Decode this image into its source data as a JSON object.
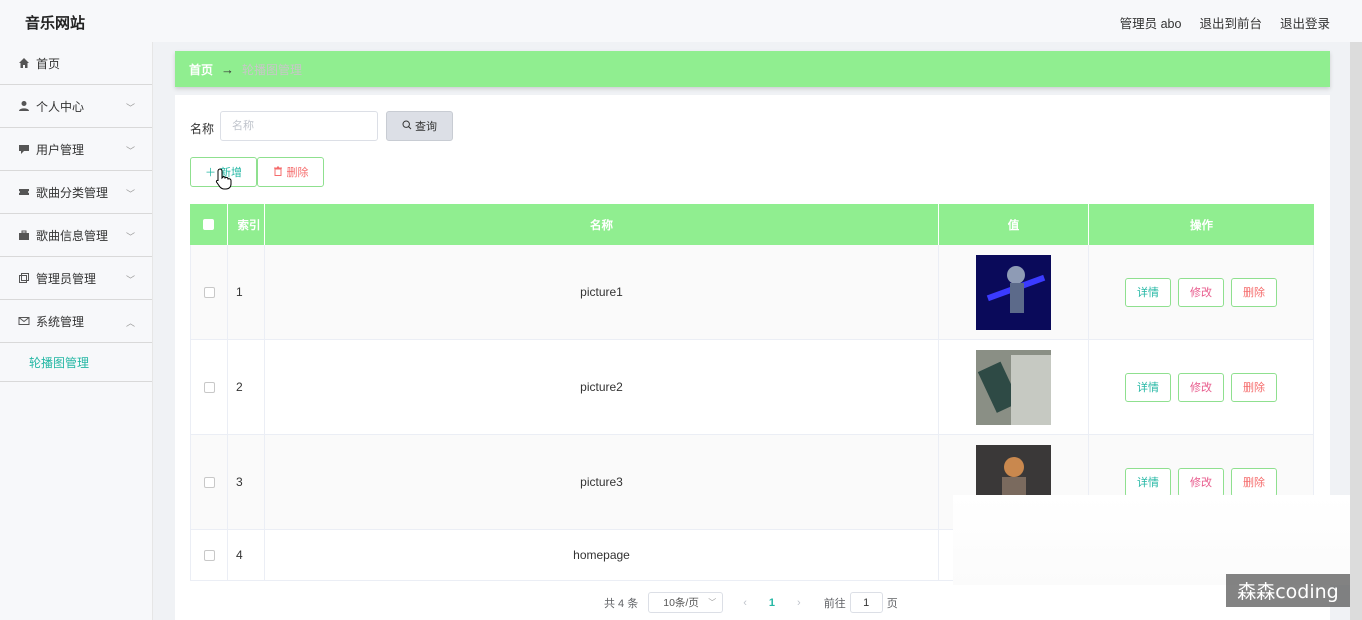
{
  "header": {
    "title": "音乐网站",
    "admin": "管理员 abo",
    "exit_front": "退出到前台",
    "logout": "退出登录"
  },
  "sidebar": {
    "items": [
      {
        "label": "首页",
        "icon": "home-icon"
      },
      {
        "label": "个人中心",
        "icon": "user-icon"
      },
      {
        "label": "用户管理",
        "icon": "chat-icon"
      },
      {
        "label": "歌曲分类管理",
        "icon": "ticket-icon"
      },
      {
        "label": "歌曲信息管理",
        "icon": "briefcase-icon"
      },
      {
        "label": "管理员管理",
        "icon": "copy-icon"
      },
      {
        "label": "系统管理",
        "icon": "mail-icon"
      }
    ],
    "submenu": "轮播图管理"
  },
  "breadcrumb": {
    "home": "首页",
    "arrow": "→",
    "current": "轮播图管理"
  },
  "search": {
    "label": "名称",
    "placeholder": "名称",
    "button": "查询"
  },
  "actions": {
    "add": "新增",
    "delete": "删除"
  },
  "table": {
    "headers": {
      "index": "索引",
      "name": "名称",
      "value": "值",
      "ops": "操作"
    },
    "rows": [
      {
        "index": "1",
        "name": "picture1"
      },
      {
        "index": "2",
        "name": "picture2"
      },
      {
        "index": "3",
        "name": "picture3"
      },
      {
        "index": "4",
        "name": "homepage"
      }
    ],
    "op_labels": {
      "detail": "详情",
      "edit": "修改",
      "delete": "删除"
    }
  },
  "pager": {
    "total": "共 4 条",
    "size": "10条/页",
    "page": "1",
    "goto": "前往",
    "goto_value": "1",
    "page_unit": "页"
  },
  "watermark": "森森coding",
  "colors": {
    "accent_green": "#90ee90",
    "teal": "#24b7a4",
    "danger": "#f56c6c"
  }
}
